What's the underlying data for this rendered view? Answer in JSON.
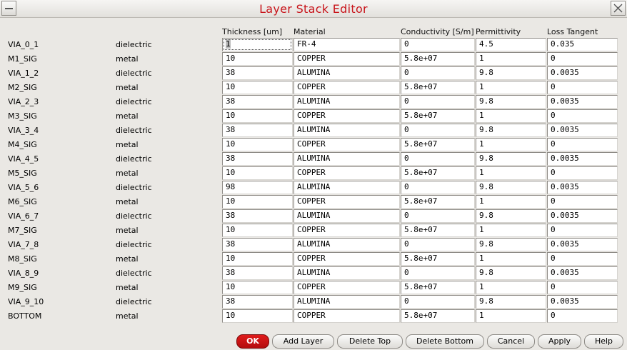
{
  "window": {
    "title": "Layer Stack Editor"
  },
  "columns": [
    "Thickness [um]",
    "Material",
    "Conductivity [S/m]",
    "Permittivity",
    "Loss Tangent"
  ],
  "layers": [
    {
      "name": "VIA_0_1",
      "type": "dielectric",
      "thickness": "1",
      "material": "FR-4",
      "conductivity": "0",
      "permittivity": "4.5",
      "loss_tangent": "0.035"
    },
    {
      "name": "M1_SIG",
      "type": "metal",
      "thickness": "10",
      "material": "COPPER",
      "conductivity": "5.8e+07",
      "permittivity": "1",
      "loss_tangent": "0"
    },
    {
      "name": "VIA_1_2",
      "type": "dielectric",
      "thickness": "38",
      "material": "ALUMINA",
      "conductivity": "0",
      "permittivity": "9.8",
      "loss_tangent": "0.0035"
    },
    {
      "name": "M2_SIG",
      "type": "metal",
      "thickness": "10",
      "material": "COPPER",
      "conductivity": "5.8e+07",
      "permittivity": "1",
      "loss_tangent": "0"
    },
    {
      "name": "VIA_2_3",
      "type": "dielectric",
      "thickness": "38",
      "material": "ALUMINA",
      "conductivity": "0",
      "permittivity": "9.8",
      "loss_tangent": "0.0035"
    },
    {
      "name": "M3_SIG",
      "type": "metal",
      "thickness": "10",
      "material": "COPPER",
      "conductivity": "5.8e+07",
      "permittivity": "1",
      "loss_tangent": "0"
    },
    {
      "name": "VIA_3_4",
      "type": "dielectric",
      "thickness": "38",
      "material": "ALUMINA",
      "conductivity": "0",
      "permittivity": "9.8",
      "loss_tangent": "0.0035"
    },
    {
      "name": "M4_SIG",
      "type": "metal",
      "thickness": "10",
      "material": "COPPER",
      "conductivity": "5.8e+07",
      "permittivity": "1",
      "loss_tangent": "0"
    },
    {
      "name": "VIA_4_5",
      "type": "dielectric",
      "thickness": "38",
      "material": "ALUMINA",
      "conductivity": "0",
      "permittivity": "9.8",
      "loss_tangent": "0.0035"
    },
    {
      "name": "M5_SIG",
      "type": "metal",
      "thickness": "10",
      "material": "COPPER",
      "conductivity": "5.8e+07",
      "permittivity": "1",
      "loss_tangent": "0"
    },
    {
      "name": "VIA_5_6",
      "type": "dielectric",
      "thickness": "98",
      "material": "ALUMINA",
      "conductivity": "0",
      "permittivity": "9.8",
      "loss_tangent": "0.0035"
    },
    {
      "name": "M6_SIG",
      "type": "metal",
      "thickness": "10",
      "material": "COPPER",
      "conductivity": "5.8e+07",
      "permittivity": "1",
      "loss_tangent": "0"
    },
    {
      "name": "VIA_6_7",
      "type": "dielectric",
      "thickness": "38",
      "material": "ALUMINA",
      "conductivity": "0",
      "permittivity": "9.8",
      "loss_tangent": "0.0035"
    },
    {
      "name": "M7_SIG",
      "type": "metal",
      "thickness": "10",
      "material": "COPPER",
      "conductivity": "5.8e+07",
      "permittivity": "1",
      "loss_tangent": "0"
    },
    {
      "name": "VIA_7_8",
      "type": "dielectric",
      "thickness": "38",
      "material": "ALUMINA",
      "conductivity": "0",
      "permittivity": "9.8",
      "loss_tangent": "0.0035"
    },
    {
      "name": "M8_SIG",
      "type": "metal",
      "thickness": "10",
      "material": "COPPER",
      "conductivity": "5.8e+07",
      "permittivity": "1",
      "loss_tangent": "0"
    },
    {
      "name": "VIA_8_9",
      "type": "dielectric",
      "thickness": "38",
      "material": "ALUMINA",
      "conductivity": "0",
      "permittivity": "9.8",
      "loss_tangent": "0.0035"
    },
    {
      "name": "M9_SIG",
      "type": "metal",
      "thickness": "10",
      "material": "COPPER",
      "conductivity": "5.8e+07",
      "permittivity": "1",
      "loss_tangent": "0"
    },
    {
      "name": "VIA_9_10",
      "type": "dielectric",
      "thickness": "38",
      "material": "ALUMINA",
      "conductivity": "0",
      "permittivity": "9.8",
      "loss_tangent": "0.0035"
    },
    {
      "name": "BOTTOM",
      "type": "metal",
      "thickness": "10",
      "material": "COPPER",
      "conductivity": "5.8e+07",
      "permittivity": "1",
      "loss_tangent": "0"
    }
  ],
  "buttons": [
    {
      "id": "ok",
      "label": "OK"
    },
    {
      "id": "add-layer",
      "label": "Add Layer"
    },
    {
      "id": "delete-top",
      "label": "Delete Top"
    },
    {
      "id": "delete-bottom",
      "label": "Delete Bottom"
    },
    {
      "id": "cancel",
      "label": "Cancel"
    },
    {
      "id": "apply",
      "label": "Apply"
    },
    {
      "id": "help",
      "label": "Help"
    }
  ],
  "colors": {
    "title": "#c8141a",
    "ok_button": "#c8141a",
    "background": "#eae8e4"
  },
  "icons": {
    "minimize": "minimize-icon",
    "close": "close-icon"
  }
}
